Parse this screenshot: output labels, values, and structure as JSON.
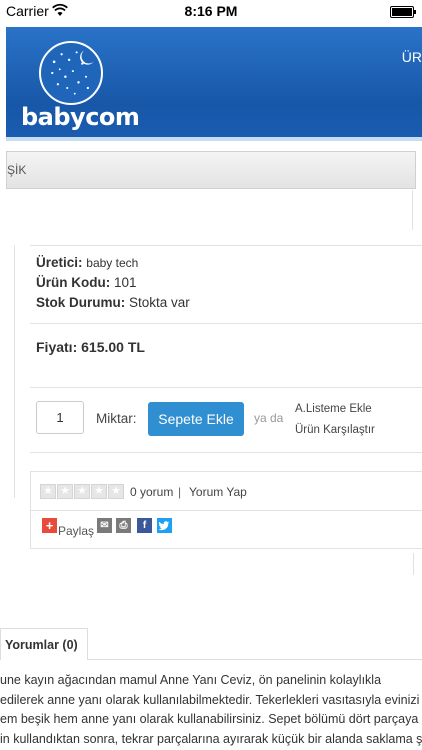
{
  "status_bar": {
    "carrier": "Carrier",
    "time": "8:16 PM"
  },
  "header": {
    "logo_text": "babycom",
    "right_text": "ÜR"
  },
  "navbar": {
    "label": "ŞİK"
  },
  "product": {
    "manufacturer_label": "Üretici:",
    "manufacturer_value": "baby tech",
    "code_label": "Ürün Kodu:",
    "code_value": "101",
    "stock_label": "Stok Durumu:",
    "stock_value": "Stokta var",
    "price_label": "Fiyatı:",
    "price_value": "615.00 TL"
  },
  "cart": {
    "quantity": "1",
    "quantity_label": "Miktar:",
    "add_button": "Sepete Ekle",
    "or_text": "ya da",
    "wishlist_link": "A.Listeme Ekle",
    "compare_link": "Ürün Karşılaştır"
  },
  "reviews": {
    "rating": 0,
    "rating_max": 5,
    "count_text": "0 yorum",
    "separator": "|",
    "write_review": "Yorum Yap"
  },
  "share": {
    "label": "Paylaş"
  },
  "tabs": {
    "reviews_tab": "Yorumlar (0)"
  },
  "description": {
    "lines": [
      "une kayın ağacından mamul Anne Yanı Ceviz, ön panelinin kolaylıkla",
      "edilerek anne yanı olarak kullanılabilmektedir. Tekerlekleri vasıtasıyla evinizi",
      "em beşik hem anne yanı olarak kullanabilirsiniz. Sepet bölümü dört parçaya",
      "in kullandıktan sonra, tekrar parçalarına ayırarak küçük bir alanda saklama ş"
    ]
  },
  "colors": {
    "header_blue": "#1757a8",
    "button_blue": "#2f8fd0",
    "share_red": "#e84b3b",
    "facebook": "#3b5998",
    "twitter": "#1da1f2"
  }
}
